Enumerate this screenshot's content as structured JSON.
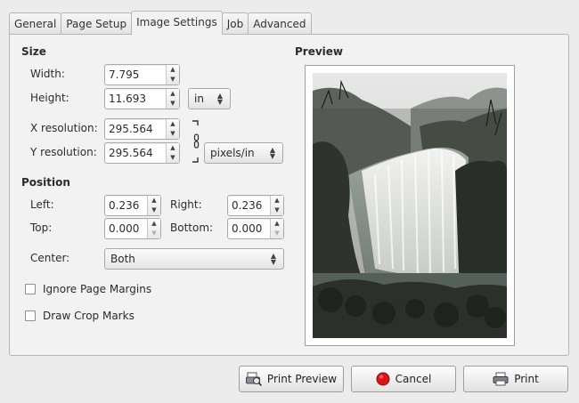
{
  "tabs": [
    "General",
    "Page Setup",
    "Image Settings",
    "Job",
    "Advanced"
  ],
  "active_tab": "Image Settings",
  "size": {
    "title": "Size",
    "width_label": "Width:",
    "width_value": "7.795",
    "height_label": "Height:",
    "height_value": "11.693",
    "size_unit": "in",
    "xres_label": "X resolution:",
    "xres_value": "295.564",
    "yres_label": "Y resolution:",
    "yres_value": "295.564",
    "res_unit": "pixels/in"
  },
  "position": {
    "title": "Position",
    "left_label": "Left:",
    "left_value": "0.236",
    "right_label": "Right:",
    "right_value": "0.236",
    "top_label": "Top:",
    "top_value": "0.000",
    "bottom_label": "Bottom:",
    "bottom_value": "0.000",
    "center_label": "Center:",
    "center_value": "Both"
  },
  "options": {
    "ignore_margins": "Ignore Page Margins",
    "ignore_margins_checked": false,
    "crop_marks": "Draw Crop Marks",
    "crop_marks_checked": false
  },
  "preview": {
    "title": "Preview"
  },
  "buttons": {
    "print_preview": "Print Preview",
    "cancel": "Cancel",
    "print": "Print"
  },
  "colors": {
    "cancel_icon": "#d9151b",
    "window_bg": "#ececec"
  },
  "icons": [
    "chain-link-icon",
    "print-preview-icon",
    "cancel-icon",
    "printer-icon"
  ]
}
